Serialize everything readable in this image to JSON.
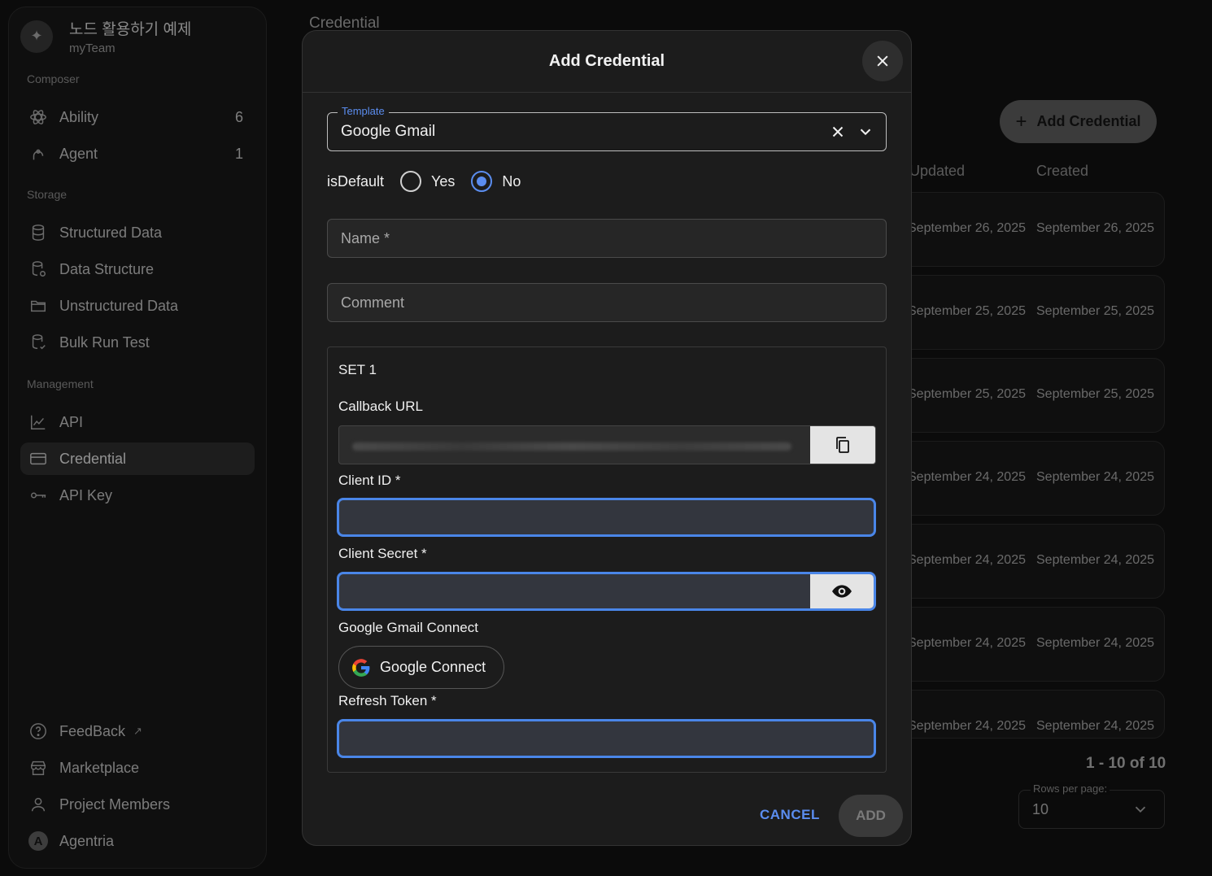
{
  "workspace": {
    "title": "노드 활용하기 예제",
    "team": "myTeam"
  },
  "sidebar": {
    "sections": {
      "composer": "Composer",
      "storage": "Storage",
      "management": "Management"
    },
    "items": [
      {
        "label": "Ability",
        "count": "6"
      },
      {
        "label": "Agent",
        "count": "1"
      },
      {
        "label": "Structured Data"
      },
      {
        "label": "Data Structure"
      },
      {
        "label": "Unstructured Data"
      },
      {
        "label": "Bulk Run Test"
      },
      {
        "label": "API"
      },
      {
        "label": "Credential"
      },
      {
        "label": "API Key"
      },
      {
        "label": "FeedBack"
      },
      {
        "label": "Marketplace"
      },
      {
        "label": "Project Members"
      },
      {
        "label": "Agentria",
        "avatar": "A"
      }
    ]
  },
  "page": {
    "title": "Credential",
    "add_button": "Add Credential",
    "columns": {
      "updated": "Updated",
      "created": "Created"
    },
    "rows": [
      {
        "updated": "September 26, 2025",
        "created": "September 26, 2025"
      },
      {
        "updated": "September 25, 2025",
        "created": "September 25, 2025"
      },
      {
        "updated": "September 25, 2025",
        "created": "September 25, 2025"
      },
      {
        "updated": "September 24, 2025",
        "created": "September 24, 2025"
      },
      {
        "updated": "September 24, 2025",
        "created": "September 24, 2025"
      },
      {
        "updated": "September 24, 2025",
        "created": "September 24, 2025"
      },
      {
        "updated": "September 24, 2025",
        "created": "September 24, 2025"
      }
    ],
    "pagination": "1 - 10 of 10",
    "rows_per_page_label": "Rows per page:",
    "rows_per_page": "10"
  },
  "modal": {
    "title": "Add Credential",
    "template_label": "Template",
    "template_value": "Google Gmail",
    "is_default_label": "isDefault",
    "yes": "Yes",
    "no": "No",
    "name_placeholder": "Name *",
    "comment_placeholder": "Comment",
    "set_title": "SET 1",
    "callback_url_label": "Callback URL",
    "client_id_label": "Client ID *",
    "client_secret_label": "Client Secret *",
    "gmail_connect_label": "Google Gmail Connect",
    "google_connect": "Google Connect",
    "refresh_token_label": "Refresh Token *",
    "cancel": "CANCEL",
    "add": "ADD"
  },
  "colors": {
    "accent": "#4a86e8",
    "link": "#5b8def"
  }
}
